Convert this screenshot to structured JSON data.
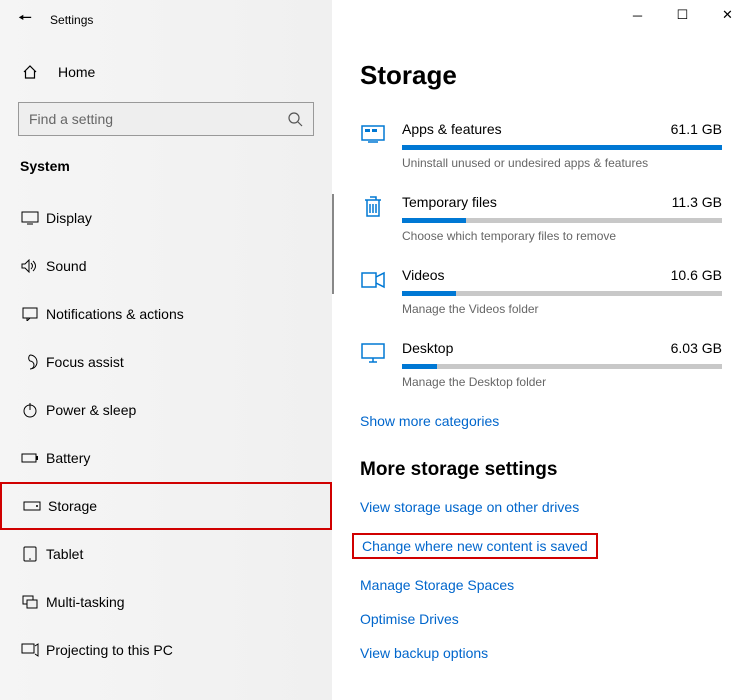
{
  "window": {
    "title": "Settings",
    "minimize": "─",
    "maximize": "☐",
    "close": "✕"
  },
  "sidebar": {
    "home_label": "Home",
    "search_placeholder": "Find a setting",
    "section": "System",
    "items": [
      {
        "label": "Display",
        "icon": "display"
      },
      {
        "label": "Sound",
        "icon": "sound"
      },
      {
        "label": "Notifications & actions",
        "icon": "notifications"
      },
      {
        "label": "Focus assist",
        "icon": "focus"
      },
      {
        "label": "Power & sleep",
        "icon": "power"
      },
      {
        "label": "Battery",
        "icon": "battery"
      },
      {
        "label": "Storage",
        "icon": "storage",
        "selected": true,
        "highlight": true
      },
      {
        "label": "Tablet",
        "icon": "tablet"
      },
      {
        "label": "Multi-tasking",
        "icon": "multitask"
      },
      {
        "label": "Projecting to this PC",
        "icon": "project"
      }
    ]
  },
  "main": {
    "heading": "Storage",
    "items": [
      {
        "name": "Apps & features",
        "size": "61.1 GB",
        "fill": 100,
        "desc": "Uninstall unused or undesired apps & features",
        "icon": "apps"
      },
      {
        "name": "Temporary files",
        "size": "11.3 GB",
        "fill": 20,
        "desc": "Choose which temporary files to remove",
        "icon": "trash"
      },
      {
        "name": "Videos",
        "size": "10.6 GB",
        "fill": 17,
        "desc": "Manage the Videos folder",
        "icon": "videos"
      },
      {
        "name": "Desktop",
        "size": "6.03 GB",
        "fill": 11,
        "desc": "Manage the Desktop folder",
        "icon": "desktop"
      }
    ],
    "show_more": "Show more categories",
    "more_heading": "More storage settings",
    "links": [
      {
        "label": "View storage usage on other drives"
      },
      {
        "label": "Change where new content is saved",
        "highlight": true
      },
      {
        "label": "Manage Storage Spaces"
      },
      {
        "label": "Optimise Drives"
      },
      {
        "label": "View backup options"
      }
    ]
  }
}
